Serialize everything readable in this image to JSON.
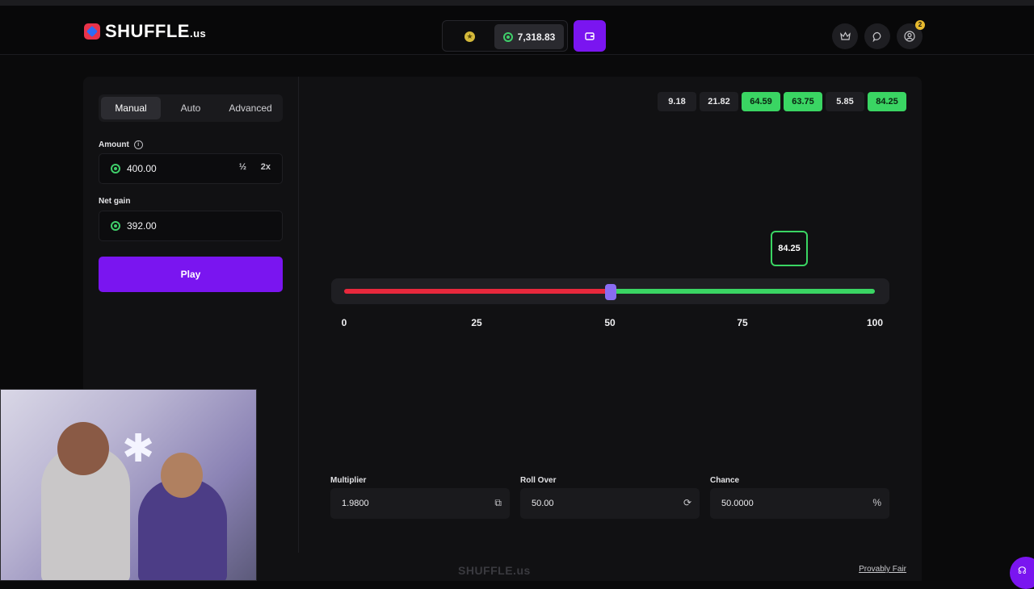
{
  "header": {
    "logo_text": "SHUFFLE",
    "logo_suffix": ".us",
    "balance": "7,318.83",
    "notification_count": "2"
  },
  "sidebar": {
    "tabs": [
      {
        "label": "Manual",
        "active": true
      },
      {
        "label": "Auto",
        "active": false
      },
      {
        "label": "Advanced",
        "active": false
      }
    ],
    "amount_label": "Amount",
    "amount_value": "400.00",
    "half_label": "½",
    "double_label": "2x",
    "net_gain_label": "Net gain",
    "net_gain_value": "392.00",
    "play_label": "Play"
  },
  "history": [
    {
      "value": "9.18",
      "win": false
    },
    {
      "value": "21.82",
      "win": false
    },
    {
      "value": "64.59",
      "win": true
    },
    {
      "value": "63.75",
      "win": true
    },
    {
      "value": "5.85",
      "win": false
    },
    {
      "value": "84.25",
      "win": true
    }
  ],
  "game": {
    "result": "84.25",
    "roll_over_fraction": 0.5,
    "ticks": [
      "0",
      "25",
      "50",
      "75",
      "100"
    ]
  },
  "controls": {
    "multiplier_label": "Multiplier",
    "multiplier_value": "1.9800",
    "roll_over_label": "Roll Over",
    "roll_over_value": "50.00",
    "chance_label": "Chance",
    "chance_value": "50.0000",
    "chance_suffix": "%"
  },
  "footer": {
    "logo_text": "SHUFFLE.us",
    "provably_fair": "Provably Fair"
  },
  "colors": {
    "accent": "#7a15f0",
    "win": "#3ad563",
    "lose": "#e8283c"
  }
}
